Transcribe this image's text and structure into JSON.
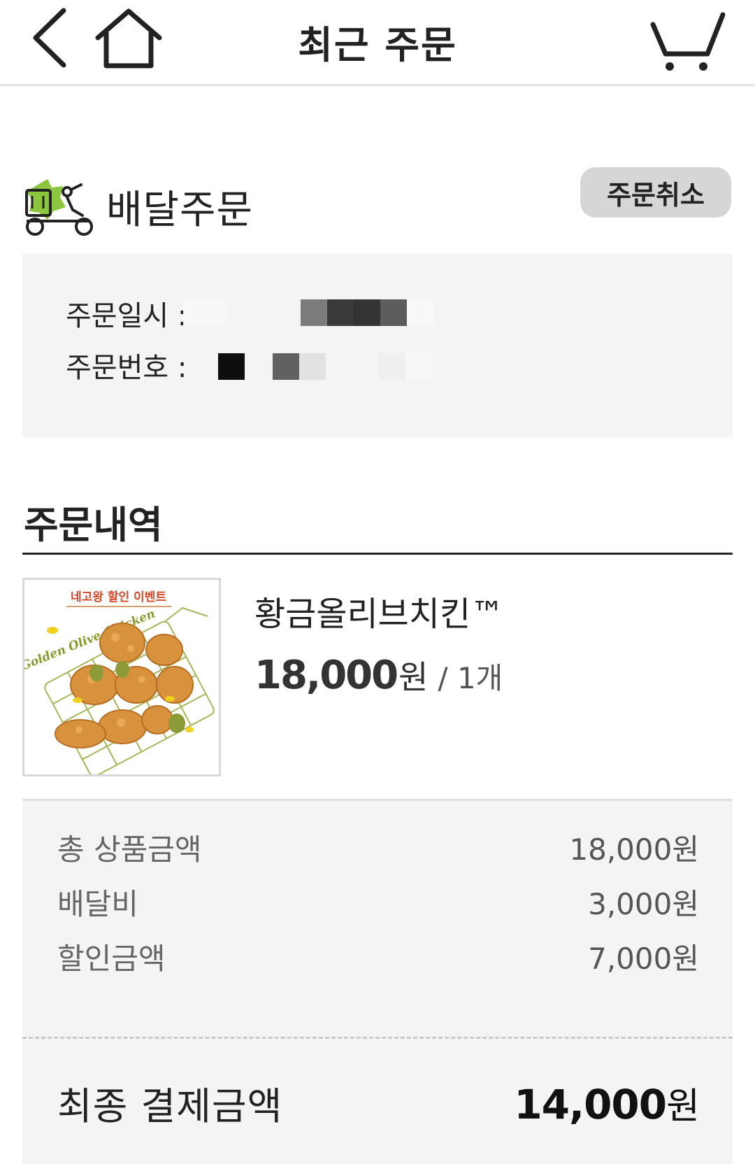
{
  "header": {
    "title": "최근 주문",
    "back_icon": "chevron-left-icon",
    "home_icon": "home-icon",
    "cart_icon": "cart-icon"
  },
  "delivery": {
    "icon": "delivery-scooter-icon",
    "label": "배달주문",
    "cancel_label": "주문취소"
  },
  "order_info": {
    "date_label": "주문일시 :",
    "number_label": "주문번호 :"
  },
  "history": {
    "title": "주문내역",
    "item": {
      "image_text": "네고왕 할인 이벤트",
      "image_brand": "Golden Olive Chicken",
      "name": "황금올리브치킨™",
      "price": "18,000",
      "currency": "원",
      "qty": "/ 1개"
    }
  },
  "summary": {
    "rows": [
      {
        "label": "총 상품금액",
        "value": "18,000원"
      },
      {
        "label": "배달비",
        "value": "3,000원"
      },
      {
        "label": "할인금액",
        "value": "7,000원"
      }
    ],
    "final_label": "최종 결제금액",
    "final_value": "14,000",
    "final_currency": "원"
  },
  "colors": {
    "accent_green": "#8cc63f",
    "cancel_bg": "#d6d6d6",
    "panel_bg": "#f4f4f4"
  }
}
